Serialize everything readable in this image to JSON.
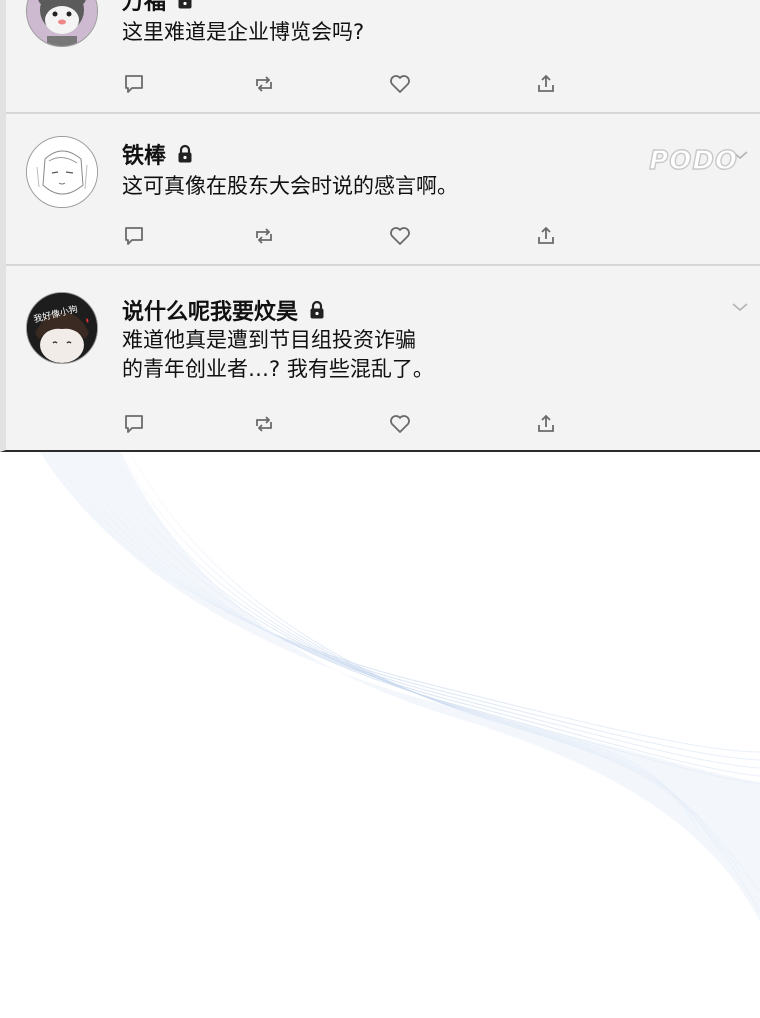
{
  "posts": [
    {
      "author": "万福",
      "text": "这里难道是企业博览会吗?",
      "locked": true,
      "avatar": "grey-bear-avatar"
    },
    {
      "author": "铁棒",
      "text": "这可真像在股东大会时说的感言啊。",
      "locked": true,
      "avatar": "sketch-face-avatar"
    },
    {
      "author": "说什么呢我要炆昊",
      "text": "难道他真是遭到节目组投资诈骗\n的青年创业者…?  我有些混乱了。",
      "locked": true,
      "avatar": "dark-hair-avatar",
      "avatar_text": "我好像小狗"
    }
  ],
  "watermark": "PODO",
  "icons": {
    "reply": "comment-icon",
    "retweet": "retweet-icon",
    "like": "heart-icon",
    "share": "share-icon",
    "lock": "lock-icon",
    "more": "chevron-down-icon"
  },
  "colors": {
    "feed_bg": "#f3f3f3",
    "icon": "#6b6b6b",
    "wave": "#bcd0ea"
  }
}
